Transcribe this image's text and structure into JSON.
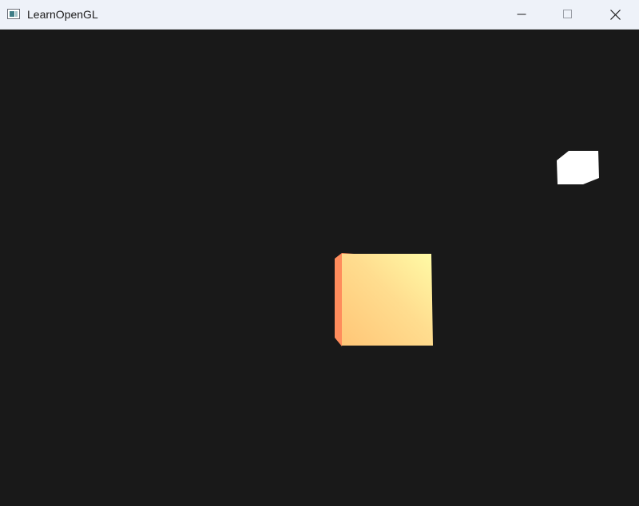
{
  "window": {
    "title": "LearnOpenGL",
    "icon": "app-window-icon",
    "controls": {
      "minimize_icon": "minimize-icon",
      "maximize_icon": "maximize-icon",
      "close_icon": "close-icon"
    }
  },
  "scene": {
    "background_color": "#191919",
    "lit_cube": {
      "front_color_light": "#fffba6",
      "front_color_dark": "#ffc677",
      "side_color": "#ff8c5c"
    },
    "light_source_color": "#ffffff"
  }
}
